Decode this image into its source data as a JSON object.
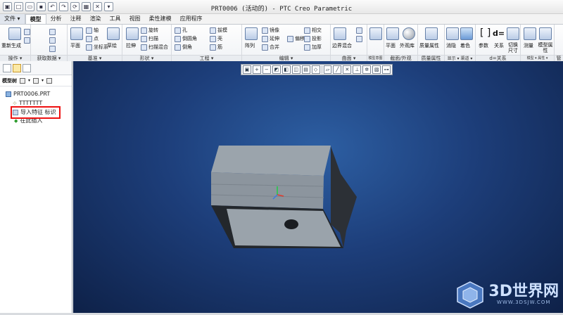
{
  "title": "PRT0006 (活动的) - PTC Creo Parametric",
  "tabs": [
    {
      "label": "文件",
      "arrow": "▾"
    },
    {
      "label": "模型"
    },
    {
      "label": "分析"
    },
    {
      "label": "注释"
    },
    {
      "label": "渲染"
    },
    {
      "label": "工具"
    },
    {
      "label": "视图"
    },
    {
      "label": "柔性建模"
    },
    {
      "label": "应用程序"
    }
  ],
  "ribbon": {
    "groups": [
      {
        "label": "操作 ▾"
      },
      {
        "label": "获取数据 ▾"
      },
      {
        "label": "基准 ▾"
      },
      {
        "label": "形状 ▾"
      },
      {
        "label": "工程 ▾"
      },
      {
        "label": "编辑 ▾"
      },
      {
        "label": "曲面 ▾"
      },
      {
        "label": "模型意图 ▾"
      },
      {
        "label": "截面/外观"
      },
      {
        "label": "质量属性"
      },
      {
        "label": "显示 ▾ 渠道 ▾"
      },
      {
        "label": "d=关系"
      },
      {
        "label": "模型 ▾ 属性 ▾"
      },
      {
        "label": "管"
      }
    ],
    "items": {
      "regenerate": "重新生成",
      "plane": "平面",
      "axis": "轴",
      "point": "点",
      "coord": "坐标系",
      "sketch": "草绘",
      "extrude": "拉伸",
      "revolve": "旋转",
      "sweep": "扫描",
      "swept_blend": "扫描混合",
      "hole": "孔",
      "round": "倒圆角",
      "chamfer": "倒角",
      "draft": "拔模",
      "shell": "壳",
      "rib": "筋",
      "pattern": "阵列",
      "mirror": "镜像",
      "extend": "延伸",
      "trim": "修剪",
      "merge": "合并",
      "offset": "偏移",
      "intersect": "相交",
      "project": "投影",
      "thicken": "加厚",
      "solidify": "实体化",
      "boundary_blend": "边界混合",
      "style": "元件界面",
      "face_plane": "平面",
      "appearance": "外观库",
      "mass_props": "质量属性",
      "hide": "消隐",
      "shading": "着色",
      "params": "参数",
      "relations": "关系",
      "switch_size": "切换尺寸",
      "measure": "测量",
      "model_props": "模型属性",
      "d_eq": "d="
    }
  },
  "left_panel": {
    "toolbar_label": "模型树",
    "tree": [
      {
        "label": "PRT0006.PRT"
      },
      {
        "label": "TTTTTTT"
      },
      {
        "label": "导入特征 标识"
      },
      {
        "label": "在此插入"
      }
    ]
  },
  "graphics_toolbar": {
    "buttons": [
      "refit-icon",
      "zoom-in-icon",
      "zoom-out-icon",
      "repaint-icon",
      "display-style-icon",
      "saved-views-icon",
      "view-manager-icon",
      "perspective-icon",
      "datum-display-icon",
      "axis-display-icon",
      "point-display-icon",
      "csys-display-icon",
      "spin-center-icon",
      "annotation-display-icon"
    ]
  },
  "watermark": {
    "text": "3D世界网",
    "url": "WWW.3DSJW.COM"
  },
  "colors": {
    "viewport_bg": "#1d3e7a",
    "part_top": "#9ba4ac",
    "part_side": "#2c3036",
    "highlight": "#e11111"
  }
}
